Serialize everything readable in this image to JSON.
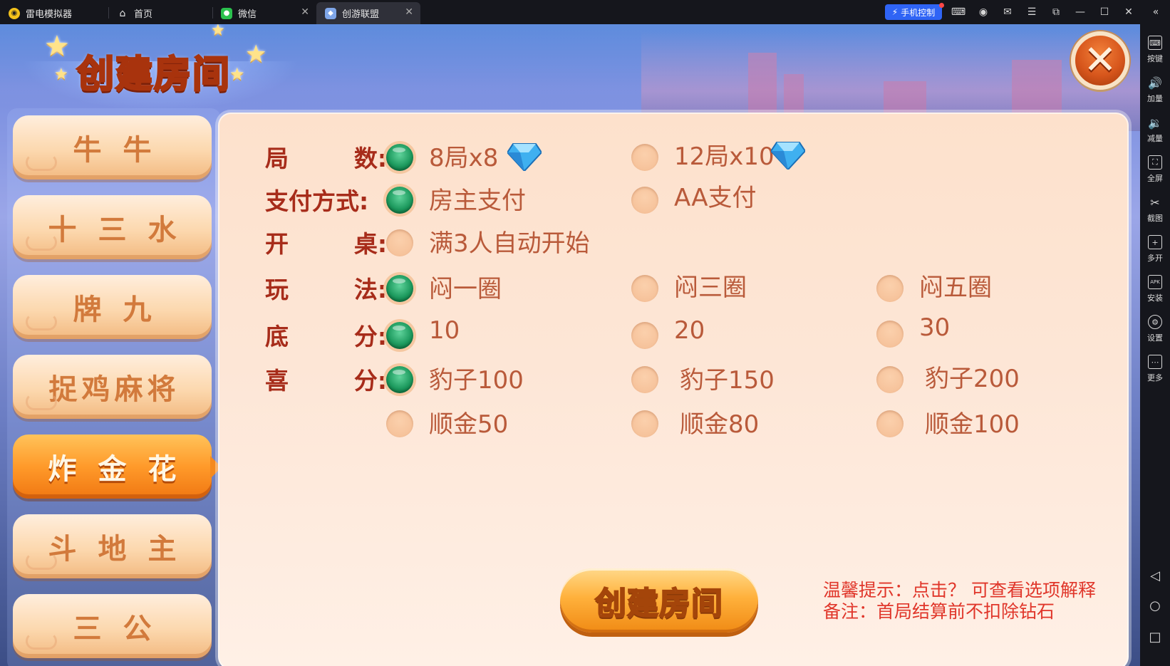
{
  "emulator": {
    "tabs": [
      {
        "label": "雷电模拟器",
        "icon": "ldplayer-logo-icon"
      },
      {
        "label": "首页",
        "icon": "home-icon"
      },
      {
        "label": "微信",
        "icon": "wechat-icon"
      },
      {
        "label": "创游联盟",
        "icon": "game-app-icon"
      }
    ],
    "phone_control": "手机控制",
    "right_tools": [
      "按键",
      "加量",
      "减量",
      "全屏",
      "截图",
      "多开",
      "安装",
      "设置",
      "更多"
    ]
  },
  "game": {
    "title": "创建房间",
    "close_symbol": "✕",
    "side_tabs": [
      "牛牛",
      "十三水",
      "牌九",
      "捉鸡麻将",
      "炸金花",
      "斗地主",
      "三公"
    ],
    "selected_tab": "炸金花",
    "options": {
      "rounds": {
        "label": "局        数:",
        "choices": [
          "8局x8",
          "12局x10"
        ],
        "selected": 0
      },
      "payment": {
        "label": "支付方式:",
        "choices": [
          "房主支付",
          "AA支付"
        ],
        "selected": 0
      },
      "start": {
        "label": "开        桌:",
        "choices": [
          "满3人自动开始"
        ],
        "selected": -1
      },
      "play": {
        "label": "玩        法:",
        "choices": [
          "闷一圈",
          "闷三圈",
          "闷五圈"
        ],
        "selected": 0
      },
      "base": {
        "label": "底        分:",
        "choices": [
          "10",
          "20",
          "30"
        ],
        "selected": 0
      },
      "bonus": {
        "label": "喜        分:",
        "choices": [
          "豹子100",
          "豹子150",
          "豹子200"
        ],
        "selected": 0
      },
      "bonus2": {
        "choices": [
          "顺金50",
          "顺金80",
          "顺金100"
        ],
        "selected": -1
      }
    },
    "create_button": "创建房间",
    "tip_line1": "温馨提示：点击？ 可查看选项解释",
    "tip_line2": "备注：首局结算前不扣除钻石"
  },
  "colors": {
    "accent_green": "#1d9a5e",
    "label_red": "#a72c1a",
    "tip_red": "#e0362a",
    "button_orange": "#f08a14"
  }
}
